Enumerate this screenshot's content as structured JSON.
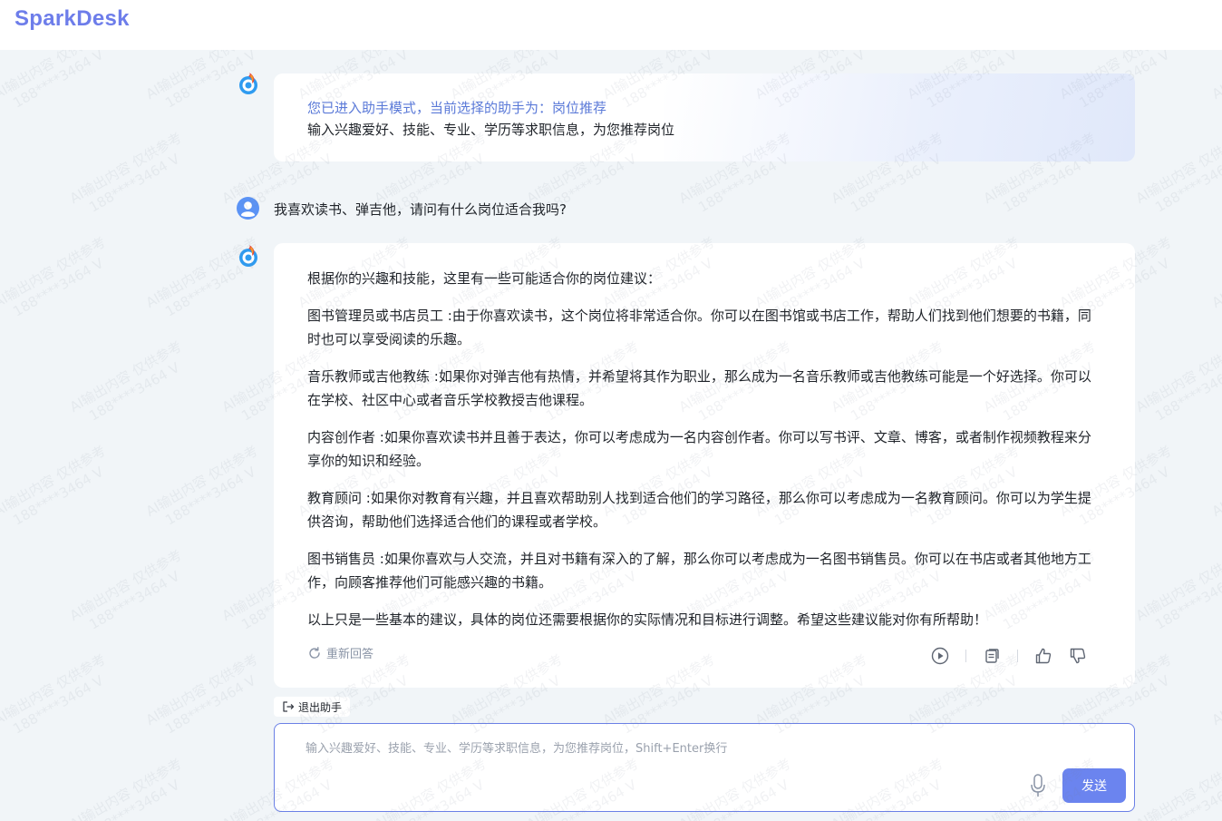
{
  "app": {
    "logo_text": "SparkDesk",
    "accent_color": "#6b84ef",
    "watermark": {
      "line1": "AI输出内容 仅供参考",
      "line2": "188****3464 V"
    }
  },
  "conversation": {
    "intro": {
      "mode_line": "您已进入助手模式，当前选择的助手为：岗位推荐",
      "hint_line": "输入兴趣爱好、技能、专业、学历等求职信息，为您推荐岗位"
    },
    "user_message": "我喜欢读书、弹吉他，请问有什么岗位适合我吗?",
    "answer": {
      "paragraphs": [
        "根据你的兴趣和技能，这里有一些可能适合你的岗位建议：",
        "图书管理员或书店员工 :由于你喜欢读书，这个岗位将非常适合你。你可以在图书馆或书店工作，帮助人们找到他们想要的书籍，同时也可以享受阅读的乐趣。",
        "音乐教师或吉他教练 :如果你对弹吉他有热情，并希望将其作为职业，那么成为一名音乐教师或吉他教练可能是一个好选择。你可以在学校、社区中心或者音乐学校教授吉他课程。",
        "内容创作者 :如果你喜欢读书并且善于表达，你可以考虑成为一名内容创作者。你可以写书评、文章、博客，或者制作视频教程来分享你的知识和经验。",
        "教育顾问 :如果你对教育有兴趣，并且喜欢帮助别人找到适合他们的学习路径，那么你可以考虑成为一名教育顾问。你可以为学生提供咨询，帮助他们选择适合他们的课程或者学校。",
        "图书销售员 :如果你喜欢与人交流，并且对书籍有深入的了解，那么你可以考虑成为一名图书销售员。你可以在书店或者其他地方工作，向顾客推荐他们可能感兴趣的书籍。",
        "以上只是一些基本的建议，具体的岗位还需要根据你的实际情况和目标进行调整。希望这些建议能对你有所帮助！"
      ],
      "regenerate_label": "重新回答",
      "action_icons": [
        "play-icon",
        "copy-icon",
        "thumbs-up-icon",
        "thumbs-down-icon"
      ]
    }
  },
  "composer": {
    "exit_assistant_label": "退出助手",
    "input_value": "",
    "input_placeholder": "输入兴趣爱好、技能、专业、学历等求职信息，为您推荐岗位，Shift+Enter换行",
    "send_label": "发送"
  }
}
